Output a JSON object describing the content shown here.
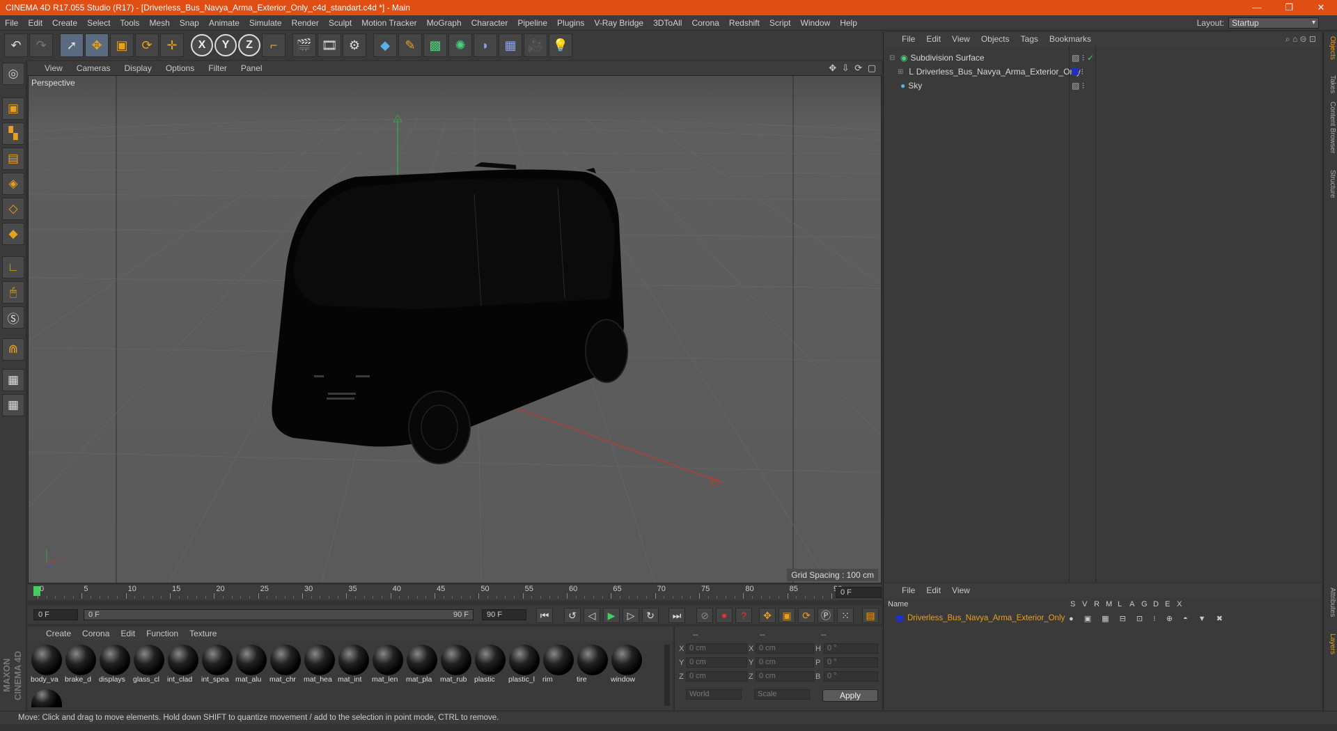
{
  "window": {
    "title": "CINEMA 4D R17.055 Studio (R17) - [Driverless_Bus_Navya_Arma_Exterior_Only_c4d_standart.c4d *] - Main",
    "minimize": "—",
    "restore": "❐",
    "close": "✕"
  },
  "menubar": {
    "items": [
      "File",
      "Edit",
      "Create",
      "Select",
      "Tools",
      "Mesh",
      "Snap",
      "Animate",
      "Simulate",
      "Render",
      "Sculpt",
      "Motion Tracker",
      "MoGraph",
      "Character",
      "Pipeline",
      "Plugins",
      "V-Ray Bridge",
      "3DToAll",
      "Corona",
      "Redshift",
      "Script",
      "Window",
      "Help"
    ],
    "layout_label": "Layout:",
    "layout_value": "Startup"
  },
  "toolbar": {
    "axis_x": "X",
    "axis_y": "Y",
    "axis_z": "Z"
  },
  "viewport": {
    "menu": [
      "View",
      "Cameras",
      "Display",
      "Options",
      "Filter",
      "Panel"
    ],
    "nav_icons": "✥ ⇩ ⟳ ▢",
    "label": "Perspective",
    "grid_spacing": "Grid Spacing : 100 cm"
  },
  "timeline": {
    "ticks": [
      "0",
      "5",
      "10",
      "15",
      "20",
      "25",
      "30",
      "35",
      "40",
      "45",
      "50",
      "55",
      "60",
      "65",
      "70",
      "75",
      "80",
      "85",
      "90"
    ],
    "current_frame": "0 F",
    "start_field": "0 F",
    "range_start": "0 F",
    "range_end": "90 F",
    "end_field": "90 F"
  },
  "materials": {
    "menu": [
      "Create",
      "Corona",
      "Edit",
      "Function",
      "Texture"
    ],
    "items": [
      "body_va",
      "brake_d",
      "displays",
      "glass_cl",
      "int_clad",
      "int_spea",
      "mat_alu",
      "mat_chr",
      "mat_hea",
      "mat_int",
      "mat_len",
      "mat_pla",
      "mat_rub",
      "plastic",
      "plastic_l",
      "rim",
      "tire",
      "window"
    ]
  },
  "coords": {
    "header1": "--",
    "header2": "--",
    "header3": "--",
    "x": "X",
    "y": "Y",
    "z": "Z",
    "h": "H",
    "p": "P",
    "b": "B",
    "val_cm": "0 cm",
    "val_deg": "0 °",
    "world": "World",
    "scale": "Scale",
    "apply": "Apply"
  },
  "status": {
    "text": "Move: Click and drag to move elements. Hold down SHIFT to quantize movement / add to the selection in point mode, CTRL to remove."
  },
  "objects": {
    "menu": [
      "File",
      "Edit",
      "View",
      "Objects",
      "Tags",
      "Bookmarks"
    ],
    "rows": [
      {
        "name": "Subdivision Surface"
      },
      {
        "name": "Driverless_Bus_Navya_Arma_Exterior_Only"
      },
      {
        "name": "Sky"
      }
    ]
  },
  "layers": {
    "menu": [
      "File",
      "Edit",
      "View"
    ],
    "col_name": "Name",
    "cols": [
      "S",
      "V",
      "R",
      "M",
      "L",
      "A",
      "G",
      "D",
      "E",
      "X"
    ],
    "row_name": "Driverless_Bus_Navya_Arma_Exterior_Only"
  },
  "side_tabs": [
    "Objects",
    "Takes",
    "Content Browser",
    "Structure",
    "Attributes",
    "Layers"
  ],
  "maxon_logo": "MAXON CINEMA 4D",
  "colors": {
    "titlebar": "#e04e14",
    "accent_orange": "#e8a020",
    "layer_name": "#e8a020"
  }
}
